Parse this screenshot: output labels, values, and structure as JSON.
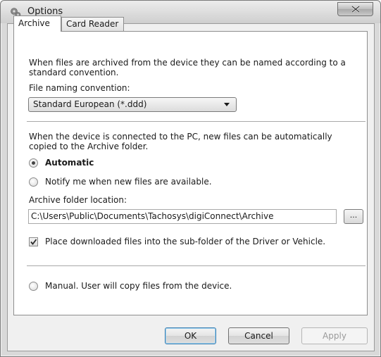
{
  "window": {
    "title": "Options",
    "close_label": "X"
  },
  "tabs": [
    {
      "label": "Archive",
      "active": true
    },
    {
      "label": "Card Reader",
      "active": false
    }
  ],
  "archive": {
    "naming_desc_line1": "When files are archived from the device they can be named according to a",
    "naming_desc_line2": "standard convention.",
    "naming_label": "File naming convention:",
    "naming_value": "Standard European (*.ddd)",
    "copy_desc_line1": "When the device is connected to the PC, new files can be automatically",
    "copy_desc_line2": "copied to the Archive folder.",
    "radio_automatic": {
      "label": "Automatic",
      "checked": true
    },
    "radio_notify": {
      "label": "Notify me when new files are available.",
      "checked": false
    },
    "folder_label": "Archive folder location:",
    "folder_value": "C:\\Users\\Public\\Documents\\Tachosys\\digiConnect\\Archive",
    "browse_label": "...",
    "subfolder_checkbox": {
      "label": "Place downloaded files into the sub-folder of the Driver or Vehicle.",
      "checked": true
    },
    "radio_manual": {
      "label": "Manual.  User will copy files from the device.",
      "checked": false
    }
  },
  "buttons": {
    "ok": "OK",
    "cancel": "Cancel",
    "apply": "Apply"
  },
  "icons": {
    "app": "gear-icon",
    "close": "close-icon",
    "dropdown": "chevron-down-icon",
    "check": "checkmark-icon"
  }
}
